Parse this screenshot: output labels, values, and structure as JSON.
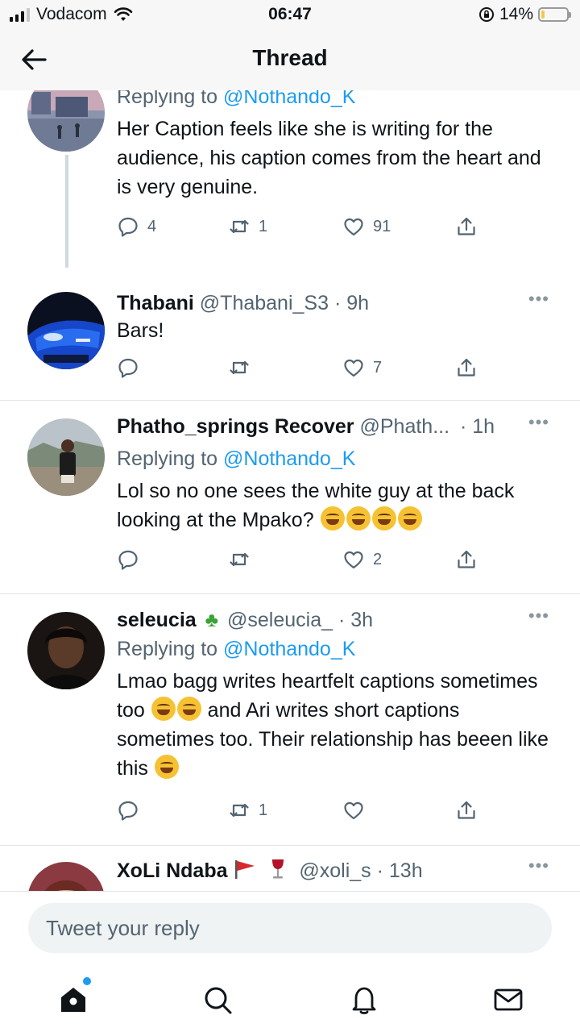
{
  "status_bar": {
    "carrier": "Vodacom",
    "time": "06:47",
    "battery_percent": "14%",
    "battery_level": 0.14,
    "icons": [
      "signal-icon",
      "wifi-icon",
      "orientation-lock-icon",
      "battery-icon"
    ]
  },
  "header": {
    "title": "Thread"
  },
  "tweets": [
    {
      "reply_prefix": "Replying to",
      "reply_to": "@Nothando_K",
      "text": "Her Caption feels like she is writing for the audience, his caption comes from the heart and is very genuine.",
      "reply_count": "4",
      "retweet_count": "1",
      "like_count": "91"
    },
    {
      "name": "Thabani",
      "handle_time": "@Thabani_S3 · 9h",
      "text": "Bars!",
      "like_count": "7"
    },
    {
      "name": "Phatho_springs Recover",
      "handle": "@Phath...",
      "time": "· 1h",
      "reply_prefix": "Replying to",
      "reply_to": "@Nothando_K",
      "text": "Lol so no one sees the white guy at the back looking at the Mpako?",
      "like_count": "2"
    },
    {
      "name": "seleucia",
      "handle_time": "@seleucia_ · 3h",
      "reply_prefix": "Replying to",
      "reply_to": "@Nothando_K",
      "text_a": "Lmao bagg writes heartfelt captions sometimes too",
      "text_b": "and Ari writes short captions sometimes too. Their relationship has beeen like this",
      "retweet_count": "1"
    },
    {
      "name": "XoLi Ndaba",
      "handle_time": "@xoli_s · 13h"
    }
  ],
  "reply_box": {
    "placeholder": "Tweet your reply"
  },
  "tabs": [
    "home-tab",
    "search-tab",
    "notifications-tab",
    "messages-tab"
  ],
  "colors": {
    "accent": "#1d9bf0",
    "muted": "#536471",
    "text": "#0f1419"
  }
}
